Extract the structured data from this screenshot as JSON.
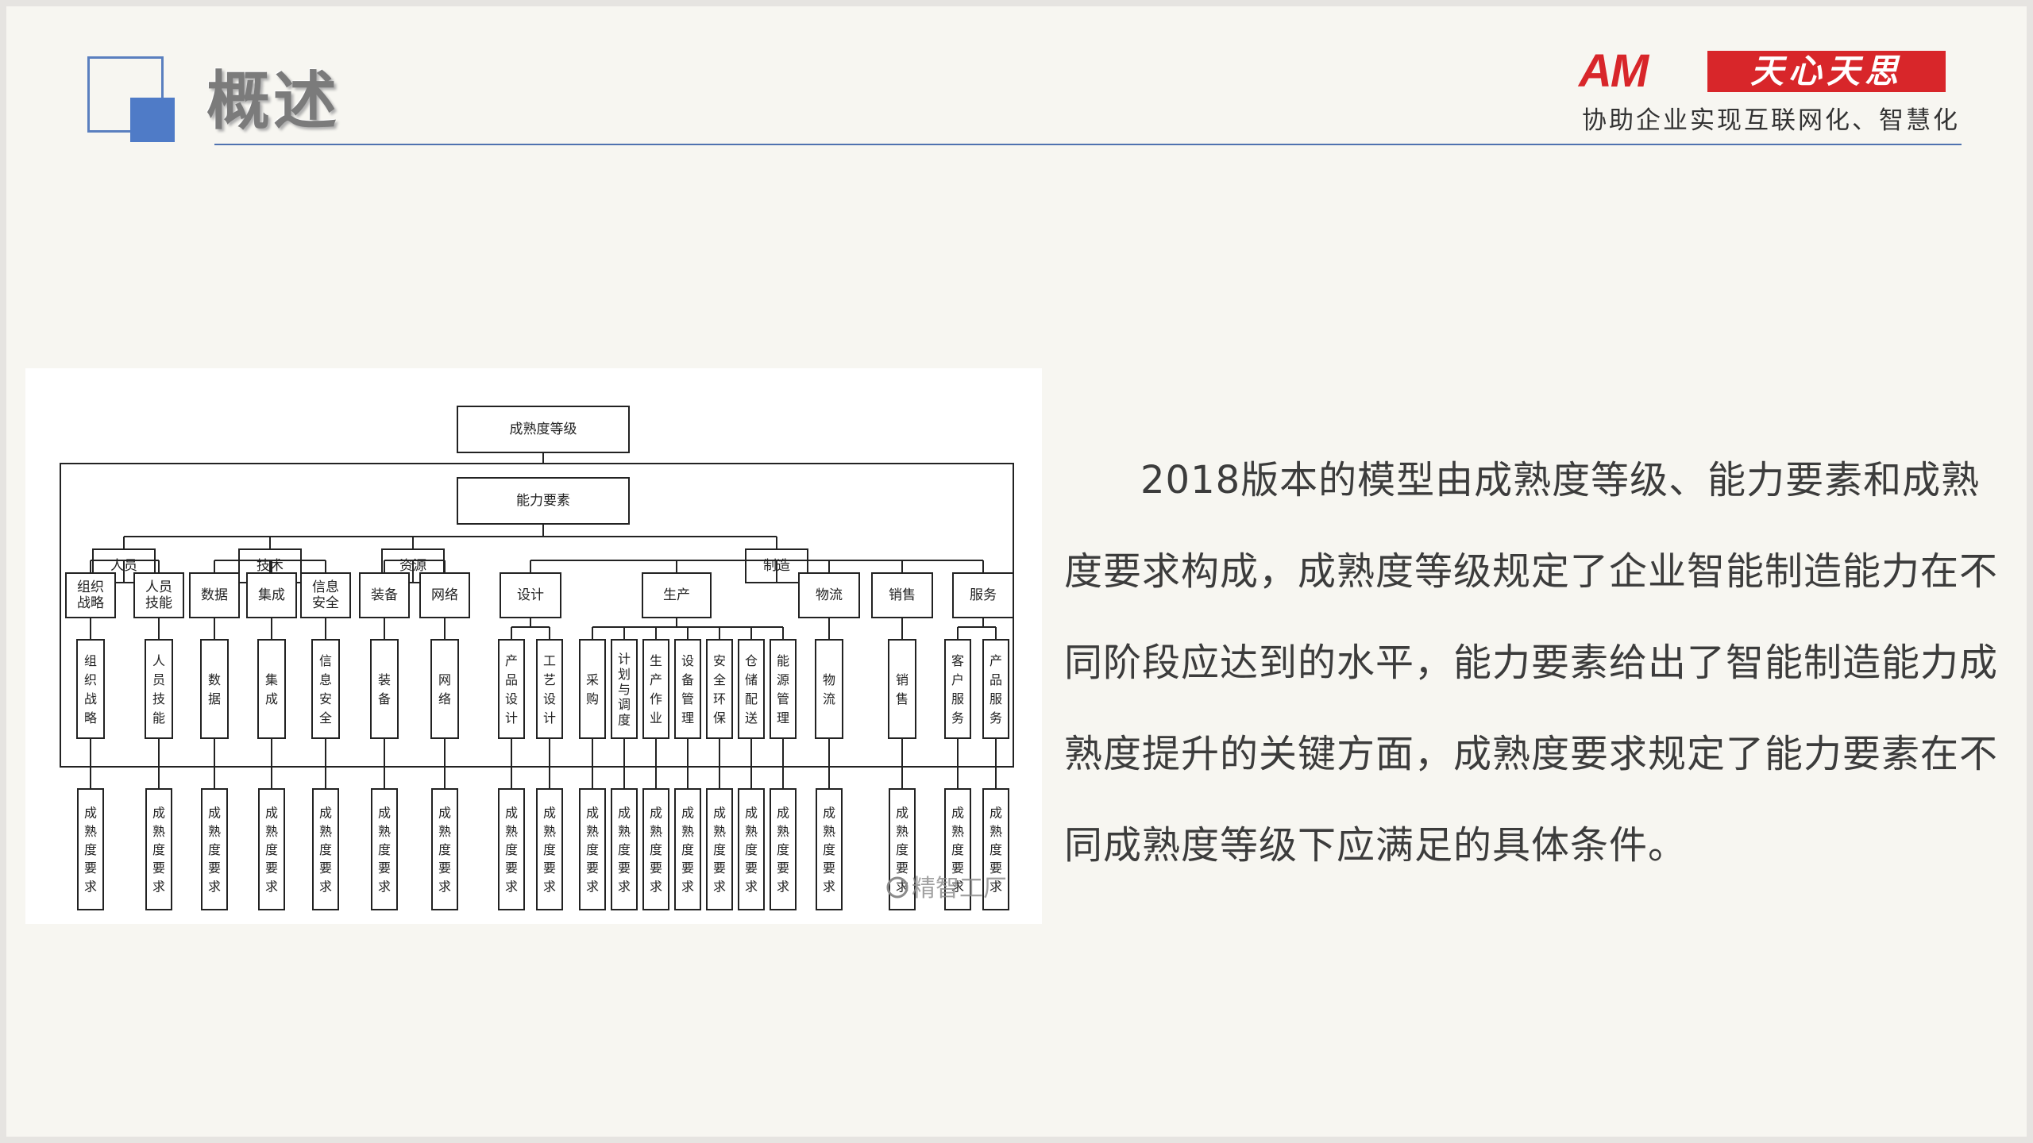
{
  "header": {
    "title": "概述",
    "logo_letters": "AM",
    "logo_brand": "天心天思",
    "tagline": "协助企业实现互联网化、智慧化"
  },
  "diagram": {
    "root": "成熟度等级",
    "capability": "能力要素",
    "groups": [
      {
        "name": "人员",
        "subs": [
          {
            "label": "组织\n战略",
            "vtext": "组织战略"
          },
          {
            "label": "人员\n技能",
            "vtext": "人员技能"
          }
        ]
      },
      {
        "name": "技术",
        "subs": [
          {
            "label": "数据",
            "vtext": "数据"
          },
          {
            "label": "集成",
            "vtext": "集成"
          },
          {
            "label": "信息\n安全",
            "vtext": "信息安全"
          }
        ]
      },
      {
        "name": "资源",
        "subs": [
          {
            "label": "装备",
            "vtext": "装备"
          },
          {
            "label": "网络",
            "vtext": "网络"
          }
        ]
      },
      {
        "name": "制造",
        "subs": [
          {
            "label": "设计",
            "children": [
              "产品设计",
              "工艺设计"
            ]
          },
          {
            "label": "生产",
            "children": [
              "采购",
              "计划与调度",
              "生产作业",
              "设备管理",
              "安全环保",
              "仓储配送",
              "能源管理"
            ]
          },
          {
            "label": "物流",
            "vtext": "物流"
          },
          {
            "label": "销售",
            "vtext": "销售"
          },
          {
            "label": "服务",
            "children": [
              "客户服务",
              "产品服务"
            ]
          }
        ]
      }
    ],
    "requirement": "成熟度要求",
    "watermark": "精智工厂"
  },
  "body": {
    "paragraph": "2018版本的模型由成熟度等级、能力要素和成熟度要求构成，成熟度等级规定了企业智能制造能力在不同阶段应达到的水平，能力要素给出了智能制造能力成熟度提升的关键方面，成熟度要求规定了能力要素在不同成熟度等级下应满足的具体条件。"
  },
  "colors": {
    "accent_blue": "#4f7bc7",
    "brand_red": "#d8262a",
    "title_gray": "#7b7b7b"
  }
}
